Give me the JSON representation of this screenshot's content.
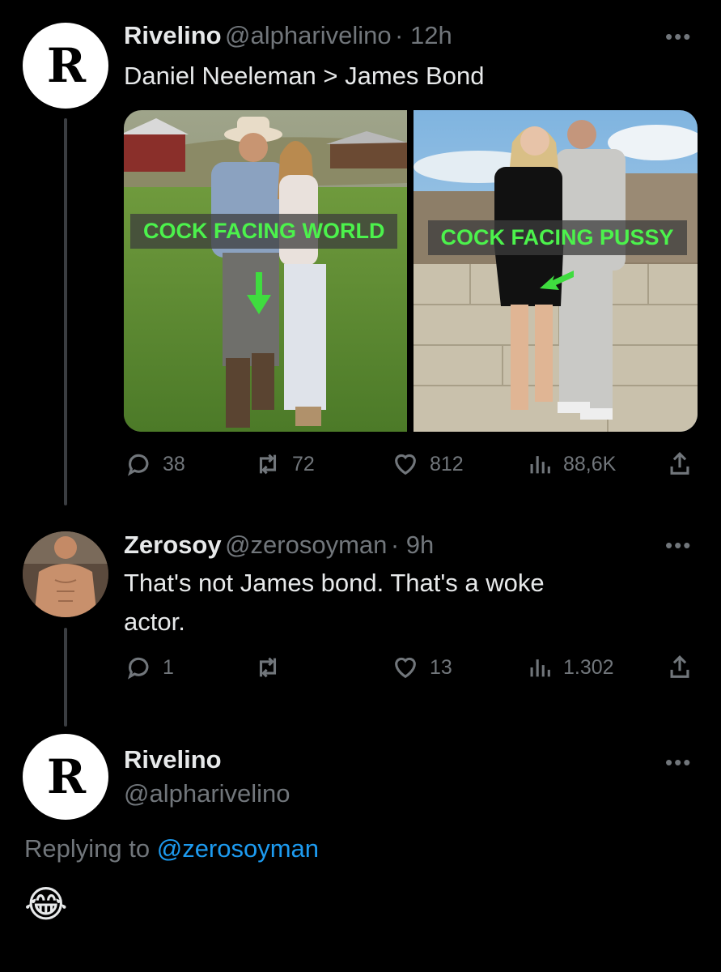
{
  "tweet1": {
    "avatar_letter": "R",
    "name": "Rivelino",
    "handle": "@alpharivelino",
    "time": "· 12h",
    "text": "Daniel Neeleman > James Bond",
    "media": {
      "left_caption": "COCK FACING WORLD",
      "right_caption": "COCK FACING PUSSY"
    },
    "stats": {
      "replies": "38",
      "retweets": "72",
      "likes": "812",
      "views": "88,6K"
    }
  },
  "tweet2": {
    "name": "Zerosoy",
    "handle": "@zerosoyman",
    "time": "· 9h",
    "text_line1": "That's not James bond. That's a woke",
    "text_line2": "actor.",
    "stats": {
      "replies": "1",
      "retweets": "",
      "likes": "13",
      "views": "1.302"
    }
  },
  "tweet3": {
    "avatar_letter": "R",
    "name": "Rivelino",
    "handle": "@alpharivelino",
    "replying_prefix": "Replying to",
    "replying_to": "@zerosoyman",
    "text": "😂"
  },
  "colors": {
    "background": "#000000",
    "text": "#e7e9ea",
    "muted": "#71767b",
    "link": "#1d9bf0",
    "caption_green": "#4cf24c"
  }
}
